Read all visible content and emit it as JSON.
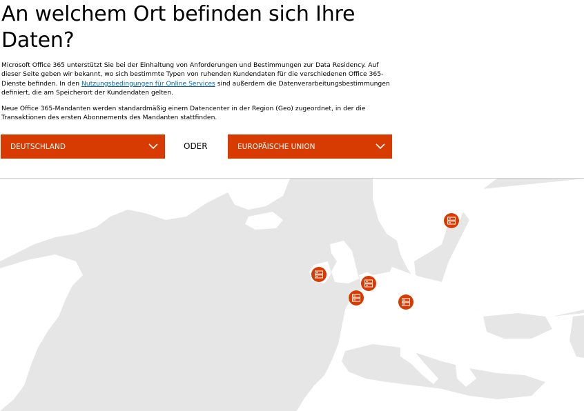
{
  "header": {
    "title": "An welchem Ort befinden sich Ihre Daten?"
  },
  "intro": {
    "part1": "Microsoft Office 365 unterstützt Sie bei der Einhaltung von Anforderungen und Bestimmungen zur Data Residency. Auf dieser Seite geben wir bekannt, wo sich bestimmte Typen von ruhenden Kundendaten für die verschiedenen Office 365-Dienste befinden. In den ",
    "link": "Nutzungsbedingungen für Online Services",
    "part2": " sind außerdem die Datenverarbeitungsbestimmungen definiert, die am Speicherort der Kundendaten gelten.",
    "paragraph2": "Neue Office 365-Mandanten werden standardmäßig einem Datencenter in der Region (Geo) zugeordnet, in der die Transaktionen des ersten Abonnements des Mandanten stattfinden."
  },
  "selectors": {
    "country": "DEUTSCHLAND",
    "or_label": "ODER",
    "region": "EUROPÄISCHE UNION"
  },
  "colors": {
    "accent": "#d83b01",
    "map_water": "#e6e6e6",
    "map_land": "#ffffff",
    "link": "#0067b8"
  },
  "map": {
    "pins": [
      {
        "name": "datacenter-pin-finland",
        "icon": "server-icon"
      },
      {
        "name": "datacenter-pin-ireland",
        "icon": "server-icon"
      },
      {
        "name": "datacenter-pin-netherlands",
        "icon": "server-icon"
      },
      {
        "name": "datacenter-pin-france",
        "icon": "server-icon"
      },
      {
        "name": "datacenter-pin-austria",
        "icon": "server-icon"
      }
    ]
  }
}
